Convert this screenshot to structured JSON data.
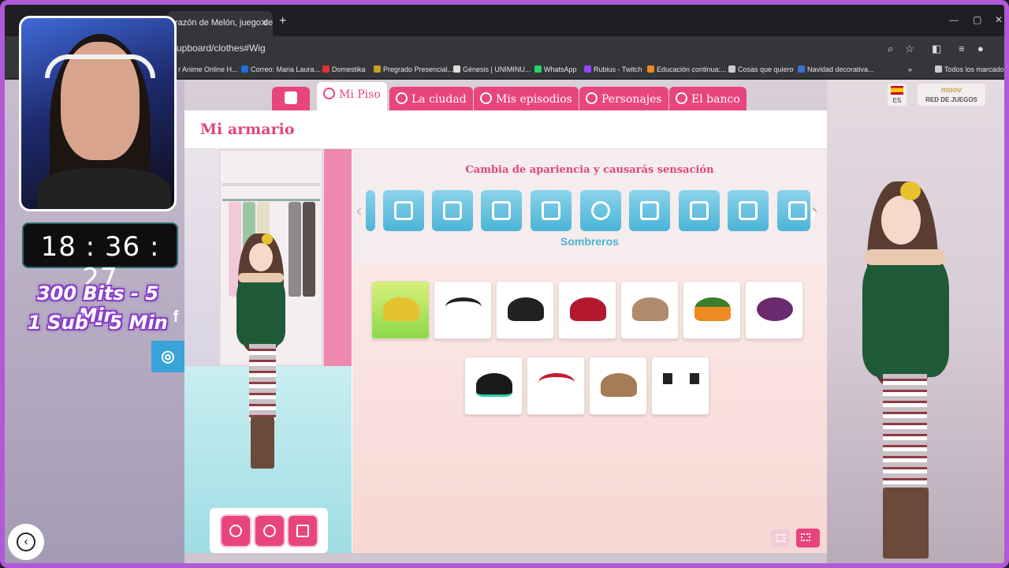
{
  "browser": {
    "tab_title": "razón de Melón, juego de ar",
    "url": "cupboard/clothes#Wig",
    "bookmarks": [
      {
        "label": "r Anime Online H...",
        "color": "#888888"
      },
      {
        "label": "Correo: Maria Laura...",
        "color": "#1e6fd9"
      },
      {
        "label": "Domestika",
        "color": "#e03030"
      },
      {
        "label": "Pregrado Presencial...",
        "color": "#c9a020"
      },
      {
        "label": "Génesis | UNIMINU...",
        "color": "#dddddd"
      },
      {
        "label": "WhatsApp",
        "color": "#25d366"
      },
      {
        "label": "Rubius - Twitch",
        "color": "#9146ff"
      },
      {
        "label": "Educación continua:...",
        "color": "#f08a24"
      },
      {
        "label": "Cosas que quiero",
        "color": "#cccccc"
      },
      {
        "label": "Navidad decorativa...",
        "color": "#3a6fd9"
      }
    ],
    "all_bookmarks": "Todos los marcadores"
  },
  "nav": {
    "tabs": [
      {
        "label": "Mi Piso",
        "active": true
      },
      {
        "label": "La ciudad"
      },
      {
        "label": "Mis episodios"
      },
      {
        "label": "Personajes"
      },
      {
        "label": "El banco"
      }
    ],
    "lang": "ES",
    "partner_logo": "moov",
    "partner": "RED DE JUEGOS"
  },
  "panel": {
    "title": "Mi armario",
    "subtitle": "Cambia de apariencia y causarás sensación",
    "category_icons": [
      "wig-icon",
      "bra-icon",
      "pants-icon",
      "socks-icon",
      "shoes-icon",
      "necklace-icon",
      "dress-icon",
      "heels-icon",
      "bracelet-icon",
      "bag-icon"
    ],
    "selected_category": "Sombreros",
    "items_row1": [
      "holly-flower-hat",
      "black-headband",
      "black-bowler-hat",
      "red-felt-hat",
      "antler-headband",
      "pumpkin-witch-hat",
      "skull-flower-hairpin"
    ],
    "items_row2": [
      "black-beret",
      "red-holly-headband",
      "tan-deerstalker-hat",
      "cat-ears"
    ],
    "selected_item": 0
  },
  "stream": {
    "timer": "18 : 36 : 27",
    "promo_line1": "300 Bits - 5 Min",
    "promo_line2": "1 Sub - 5 Min",
    "facebook": "f"
  },
  "colors": {
    "brand_pink": "#e8457e",
    "category_blue": "#4bb4d6",
    "selected_green": "#8ed84a"
  }
}
